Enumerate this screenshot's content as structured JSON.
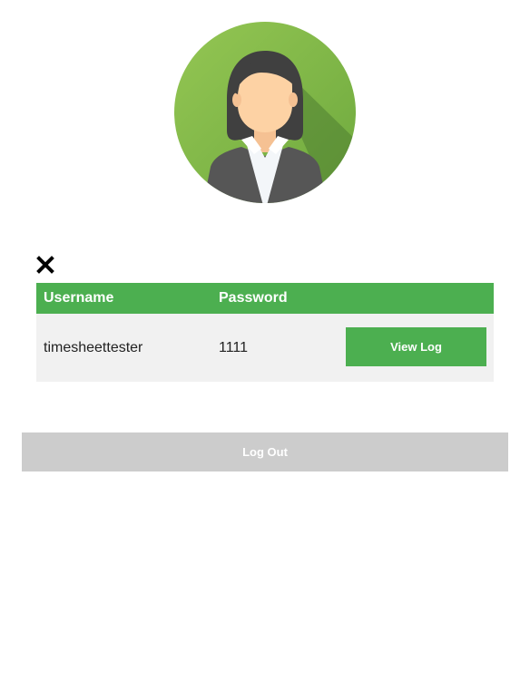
{
  "profile": {
    "avatar_icon": "user-avatar-female-icon",
    "accent_color": "#8bc34a"
  },
  "close_icon": "close-icon",
  "users_table": {
    "headers": {
      "username": "Username",
      "password": "Password"
    },
    "rows": [
      {
        "username": "timesheettester",
        "password": "1111",
        "action_label": "View Log"
      }
    ],
    "header_color": "#4caf50"
  },
  "logout_label": "Log Out"
}
